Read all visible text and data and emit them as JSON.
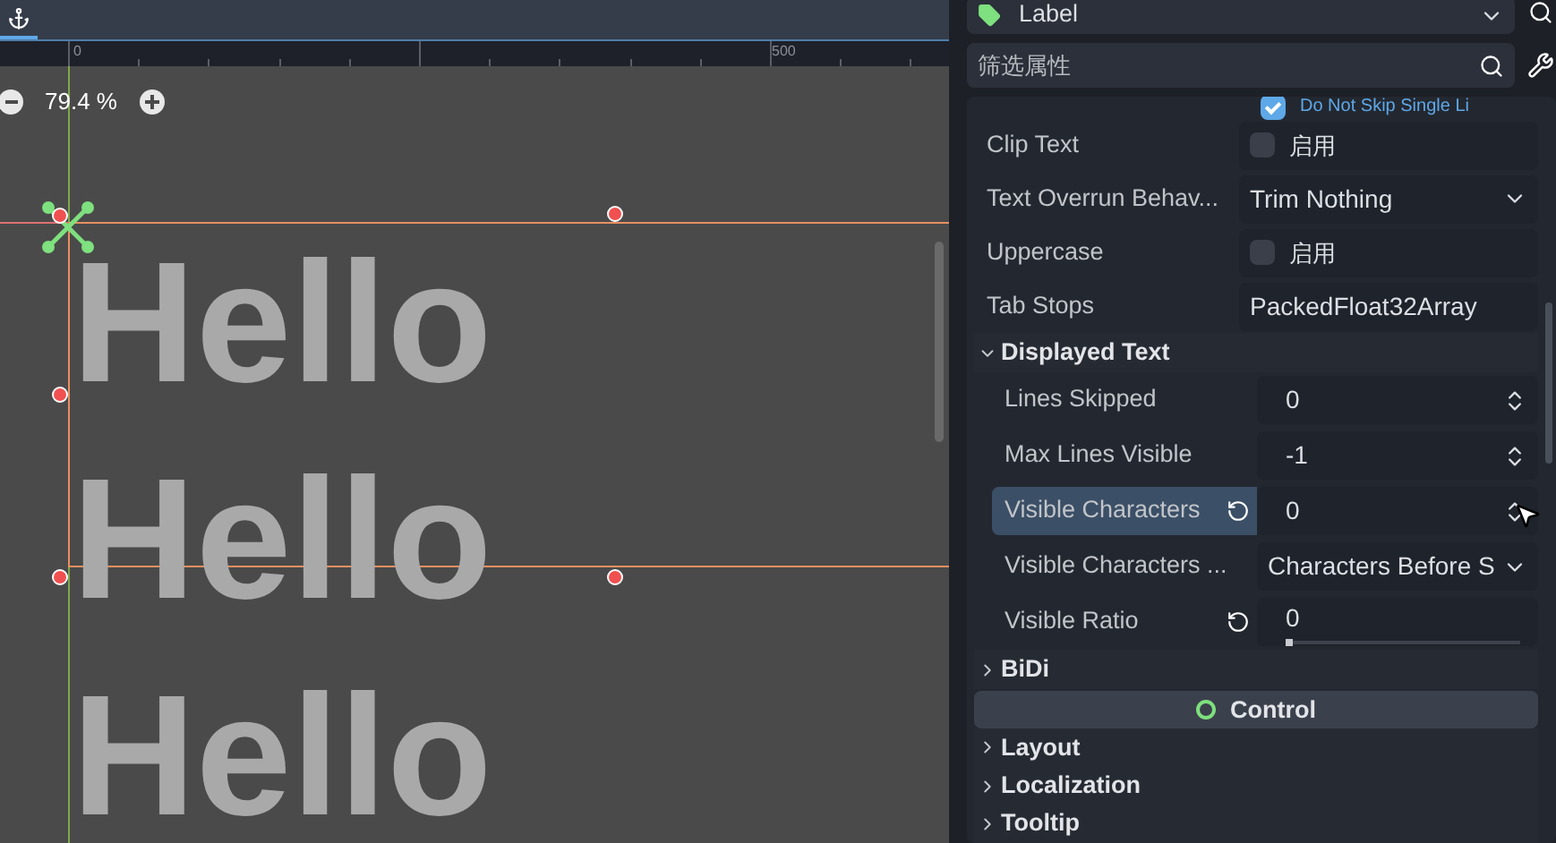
{
  "toolbar": {
    "tabs": [
      {
        "selected": true
      }
    ]
  },
  "ruler": {
    "labels": [
      "0",
      "500"
    ]
  },
  "zoom": {
    "value": "79.4 %"
  },
  "canvas": {
    "texts": [
      "Hello",
      "Hello",
      "Hello"
    ]
  },
  "inspector": {
    "node_type": "Label",
    "filter": {
      "placeholder": "筛选属性"
    },
    "partial_row": {
      "label": "Do Not Skip Single Li",
      "checked": true
    },
    "properties": [
      {
        "kind": "checkbox",
        "label": "Clip Text",
        "value": "启用",
        "checked": false
      },
      {
        "kind": "dropdown",
        "label": "Text Overrun Behav...",
        "value": "Trim Nothing"
      },
      {
        "kind": "checkbox",
        "label": "Uppercase",
        "value": "启用",
        "checked": false
      },
      {
        "kind": "resource",
        "label": "Tab Stops",
        "value": "PackedFloat32Array"
      }
    ],
    "sections": [
      {
        "title": "Displayed Text",
        "expanded": true,
        "properties": [
          {
            "kind": "spin",
            "label": "Lines Skipped",
            "value": "0",
            "selected": false,
            "revertable": false
          },
          {
            "kind": "spin",
            "label": "Max Lines Visible",
            "value": "-1",
            "selected": false,
            "revertable": false
          },
          {
            "kind": "spin",
            "label": "Visible Characters",
            "value": "0",
            "selected": true,
            "revertable": true
          },
          {
            "kind": "dropdown",
            "label": "Visible Characters ...",
            "value": "Characters Before S",
            "selected": false,
            "revertable": false
          },
          {
            "kind": "slider",
            "label": "Visible Ratio",
            "value": "0",
            "level": 0,
            "selected": false,
            "revertable": true
          }
        ]
      },
      {
        "title": "BiDi",
        "expanded": false
      }
    ],
    "category": {
      "title": "Control"
    },
    "control_sections": [
      {
        "title": "Layout",
        "expanded": false
      },
      {
        "title": "Localization",
        "expanded": false
      },
      {
        "title": "Tooltip",
        "expanded": false
      }
    ]
  }
}
